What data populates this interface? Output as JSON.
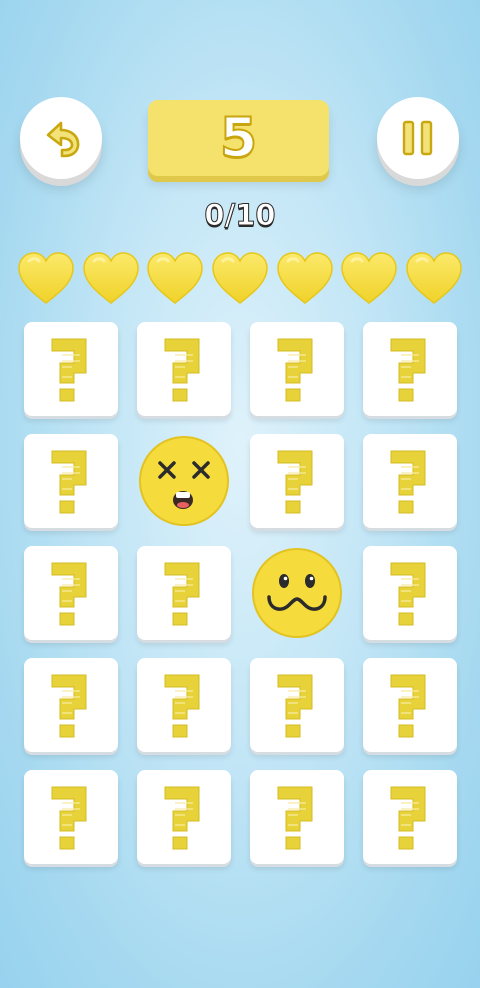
{
  "header": {
    "level": "5",
    "progress_text": "0/10",
    "undo_icon": "undo-arrow-icon",
    "pause_icon": "pause-icon"
  },
  "lives": {
    "count": 7,
    "icon": "heart-icon",
    "color": "#f5dc3c"
  },
  "board": {
    "rows": 5,
    "cols": 4,
    "tiles": [
      [
        "hidden",
        "hidden",
        "hidden",
        "hidden"
      ],
      [
        "hidden",
        "dizzy-face",
        "hidden",
        "hidden"
      ],
      [
        "hidden",
        "hidden",
        "cat-smile-face",
        "hidden"
      ],
      [
        "hidden",
        "hidden",
        "hidden",
        "hidden"
      ],
      [
        "hidden",
        "hidden",
        "hidden",
        "hidden"
      ]
    ],
    "hidden_symbol": "question-mark-icon"
  },
  "colors": {
    "accent_yellow": "#f4e26d",
    "question_mark": "#e8d23a",
    "emoji_fill": "#f5dc3c"
  }
}
